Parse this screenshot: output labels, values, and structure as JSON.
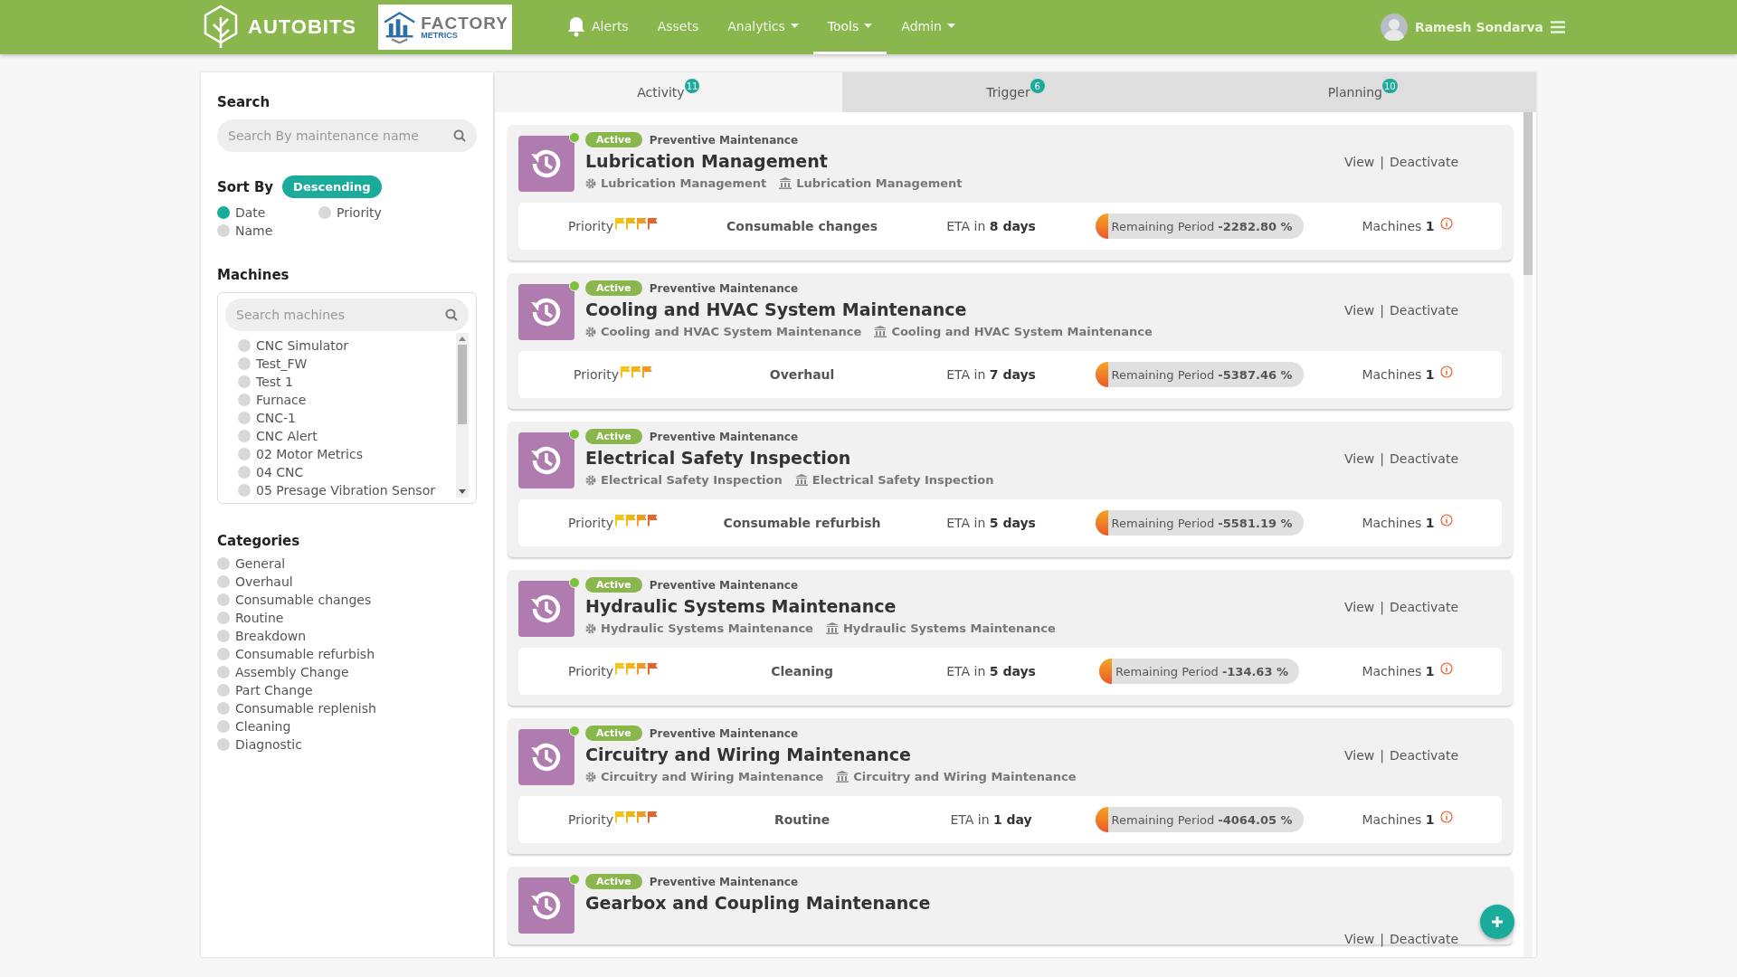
{
  "header": {
    "brand": "AUTOBITS",
    "partner_logo": {
      "line1": "FACTORY",
      "line2": "METRICS"
    },
    "nav": [
      {
        "label": "Alerts",
        "kind": "icon",
        "selected": false
      },
      {
        "label": "Assets",
        "kind": "plain",
        "selected": false
      },
      {
        "label": "Analytics",
        "kind": "dropdown",
        "selected": false
      },
      {
        "label": "Tools",
        "kind": "dropdown",
        "selected": true
      },
      {
        "label": "Admin",
        "kind": "dropdown",
        "selected": false
      }
    ],
    "user": {
      "name": "Ramesh Sondarva"
    }
  },
  "sidebar": {
    "search": {
      "title": "Search",
      "placeholder": "Search By maintenance name"
    },
    "sort": {
      "title": "Sort By",
      "order": "Descending",
      "options": [
        {
          "label": "Date",
          "selected": true
        },
        {
          "label": "Priority",
          "selected": false
        },
        {
          "label": "Name",
          "selected": false
        }
      ]
    },
    "machines": {
      "title": "Machines",
      "placeholder": "Search machines",
      "items": [
        {
          "label": "CNC Simulator",
          "checked": false
        },
        {
          "label": "Test_FW",
          "checked": false
        },
        {
          "label": "Test 1",
          "checked": false
        },
        {
          "label": "Furnace",
          "checked": false
        },
        {
          "label": "CNC-1",
          "checked": false
        },
        {
          "label": "CNC Alert",
          "checked": false
        },
        {
          "label": "02 Motor Metrics",
          "checked": false
        },
        {
          "label": "04 CNC",
          "checked": false
        },
        {
          "label": "05 Presage Vibration Sensor",
          "checked": false
        }
      ]
    },
    "categories": {
      "title": "Categories",
      "items": [
        {
          "label": "General",
          "checked": false
        },
        {
          "label": "Overhaul",
          "checked": false
        },
        {
          "label": "Consumable changes",
          "checked": false
        },
        {
          "label": "Routine",
          "checked": false
        },
        {
          "label": "Breakdown",
          "checked": false
        },
        {
          "label": "Consumable refurbish",
          "checked": false
        },
        {
          "label": "Assembly Change",
          "checked": false
        },
        {
          "label": "Part Change",
          "checked": false
        },
        {
          "label": "Consumable replenish",
          "checked": false
        },
        {
          "label": "Cleaning",
          "checked": false
        },
        {
          "label": "Diagnostic",
          "checked": false
        }
      ]
    }
  },
  "tabs": [
    {
      "label": "Activity",
      "count": "11",
      "selected": true
    },
    {
      "label": "Trigger",
      "count": "6",
      "selected": false
    },
    {
      "label": "Planning",
      "count": "10",
      "selected": false
    }
  ],
  "action_separator": "|",
  "cards": [
    {
      "kind": "full",
      "status": "Active",
      "type": "Preventive Maintenance",
      "title": "Lubrication Management",
      "component": "Lubrication Management",
      "asset": "Lubrication Management",
      "actions": [
        "View",
        "Deactivate"
      ],
      "priority_label": "Priority",
      "flags": [
        {
          "color": "#f5c518"
        },
        {
          "color": "#f5b40f"
        },
        {
          "color": "#f29a1f"
        },
        {
          "color": "#e8612a"
        }
      ],
      "category": "Consumable changes",
      "eta_prefix": "ETA in",
      "eta": "8 days",
      "remaining_label": "Remaining Period",
      "remaining": "-2282.80 %",
      "machines_label": "Machines",
      "machines": "1"
    },
    {
      "kind": "full",
      "status": "Active",
      "type": "Preventive Maintenance",
      "title": "Cooling and HVAC System Maintenance",
      "component": "Cooling and HVAC System Maintenance",
      "asset": "Cooling and HVAC System Maintenance",
      "actions": [
        "View",
        "Deactivate"
      ],
      "priority_label": "Priority",
      "flags": [
        {
          "color": "#f5c518"
        },
        {
          "color": "#f5b40f"
        },
        {
          "color": "#f29a1f"
        }
      ],
      "category": "Overhaul",
      "eta_prefix": "ETA in",
      "eta": "7 days",
      "remaining_label": "Remaining Period",
      "remaining": "-5387.46 %",
      "machines_label": "Machines",
      "machines": "1"
    },
    {
      "kind": "full",
      "status": "Active",
      "type": "Preventive Maintenance",
      "title": "Electrical Safety Inspection",
      "component": "Electrical Safety Inspection",
      "asset": "Electrical Safety Inspection",
      "actions": [
        "View",
        "Deactivate"
      ],
      "priority_label": "Priority",
      "flags": [
        {
          "color": "#f5c518"
        },
        {
          "color": "#f5b40f"
        },
        {
          "color": "#f29a1f"
        },
        {
          "color": "#e8612a"
        }
      ],
      "category": "Consumable refurbish",
      "eta_prefix": "ETA in",
      "eta": "5 days",
      "remaining_label": "Remaining Period",
      "remaining": "-5581.19 %",
      "machines_label": "Machines",
      "machines": "1"
    },
    {
      "kind": "full",
      "status": "Active",
      "type": "Preventive Maintenance",
      "title": "Hydraulic Systems Maintenance",
      "component": "Hydraulic Systems Maintenance",
      "asset": "Hydraulic Systems Maintenance",
      "actions": [
        "View",
        "Deactivate"
      ],
      "priority_label": "Priority",
      "flags": [
        {
          "color": "#f5c518"
        },
        {
          "color": "#f5b40f"
        },
        {
          "color": "#f29a1f"
        },
        {
          "color": "#e8612a"
        }
      ],
      "category": "Cleaning",
      "eta_prefix": "ETA in",
      "eta": "5 days",
      "remaining_label": "Remaining Period",
      "remaining": "-134.63 %",
      "machines_label": "Machines",
      "machines": "1"
    },
    {
      "kind": "full",
      "status": "Active",
      "type": "Preventive Maintenance",
      "title": "Circuitry and Wiring Maintenance",
      "component": "Circuitry and Wiring Maintenance",
      "asset": "Circuitry and Wiring Maintenance",
      "actions": [
        "View",
        "Deactivate"
      ],
      "priority_label": "Priority",
      "flags": [
        {
          "color": "#f5c518"
        },
        {
          "color": "#f5b40f"
        },
        {
          "color": "#f29a1f"
        },
        {
          "color": "#e8612a"
        }
      ],
      "category": "Routine",
      "eta_prefix": "ETA in",
      "eta": "1 day",
      "remaining_label": "Remaining Period",
      "remaining": "-4064.05 %",
      "machines_label": "Machines",
      "machines": "1"
    },
    {
      "kind": "partial",
      "status": "Active",
      "type": "Preventive Maintenance",
      "title": "Gearbox and Coupling Maintenance",
      "actions": [
        "View",
        "Deactivate"
      ]
    }
  ]
}
